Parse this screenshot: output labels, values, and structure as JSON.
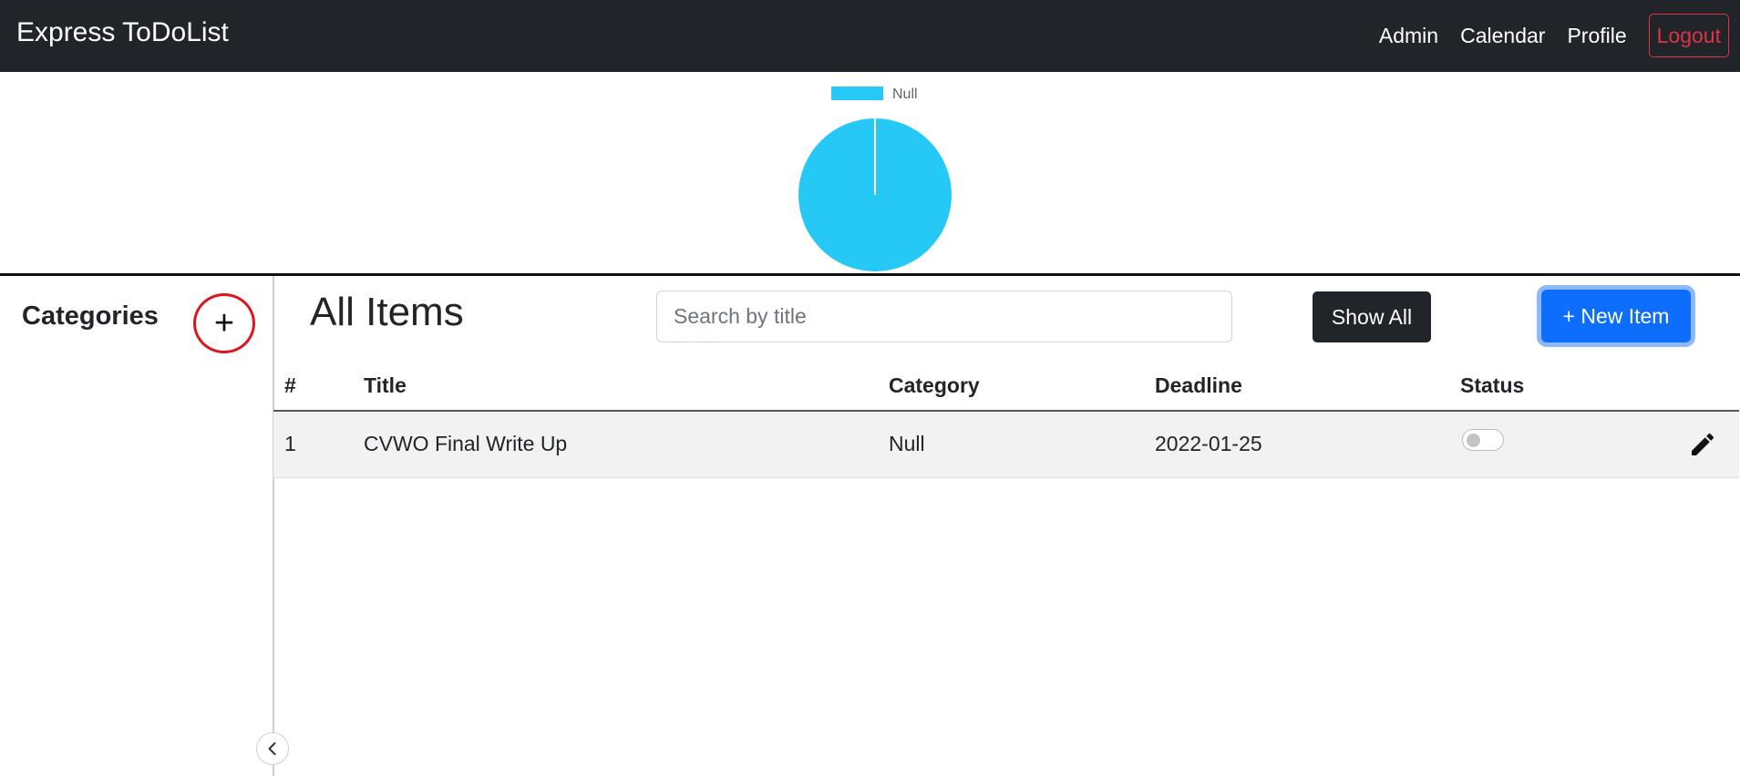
{
  "navbar": {
    "brand": "Express ToDoList",
    "links": [
      "Admin",
      "Calendar",
      "Profile"
    ],
    "logout_label": "Logout"
  },
  "chart_data": {
    "type": "pie",
    "categories": [
      "Null"
    ],
    "values": [
      1
    ],
    "colors": [
      "#26c9f5"
    ],
    "legend_position": "top"
  },
  "sidebar": {
    "title": "Categories",
    "add_icon": "plus-icon",
    "add_label": "+",
    "collapse_icon": "chevron-left-icon"
  },
  "main": {
    "title": "All Items",
    "search": {
      "placeholder": "Search by title",
      "value": ""
    },
    "show_all_label": "Show All",
    "new_item_label": "+ New Item"
  },
  "table": {
    "headers": [
      "#",
      "Title",
      "Category",
      "Deadline",
      "Status"
    ],
    "rows": [
      {
        "num": "1",
        "title": "CVWO Final Write Up",
        "category": "Null",
        "deadline": "2022-01-25",
        "status_done": false,
        "edit_icon": "pencil-icon"
      }
    ]
  },
  "colors": {
    "navbar_bg": "#212529",
    "accent": "#0d6efd",
    "danger": "#dc3545",
    "pie": "#26c9f5"
  }
}
